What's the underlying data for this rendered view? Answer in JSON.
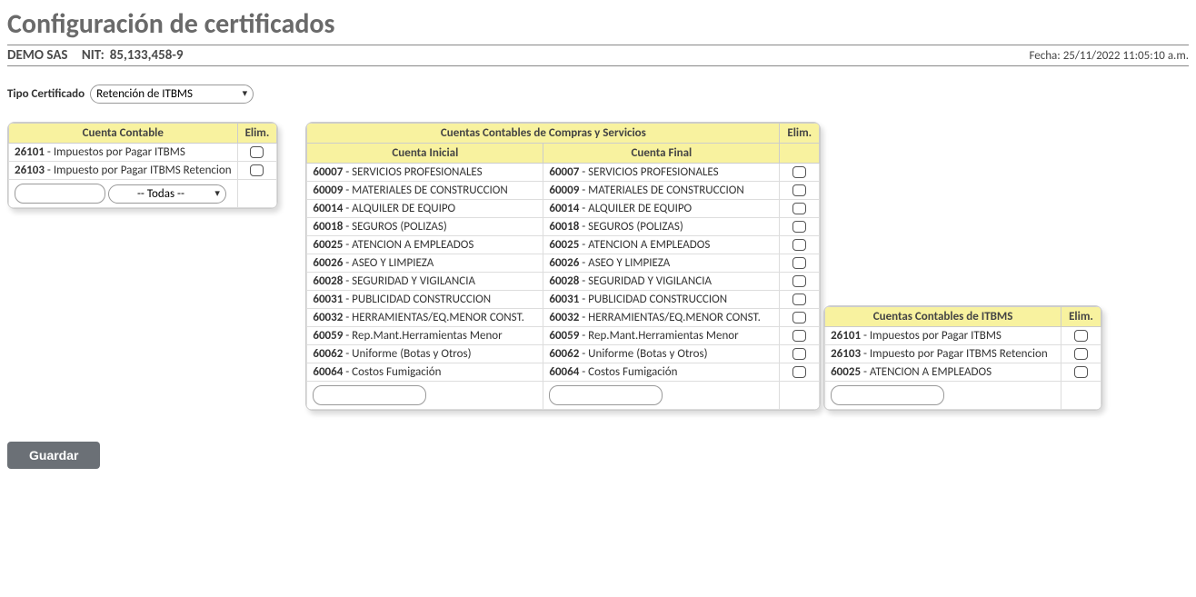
{
  "header": {
    "title": "Configuración de certificados",
    "company": "DEMO SAS",
    "nit_label": "NIT:",
    "nit_value": "85,133,458-9",
    "date_label": "Fecha:",
    "date_value": "25/11/2022 11:05:10 a.m."
  },
  "cert_type": {
    "label": "Tipo Certificado",
    "selected": "Retención de ITBMS"
  },
  "left_table": {
    "header_account": "Cuenta Contable",
    "header_delete": "Elim.",
    "rows": [
      {
        "code": "26101",
        "desc": "Impuestos por Pagar ITBMS"
      },
      {
        "code": "26103",
        "desc": "Impuesto por Pagar ITBMS Retencion"
      }
    ],
    "dropdown_value": "-- Todas --"
  },
  "purchases_table": {
    "header_main": "Cuentas Contables de Compras y Servicios",
    "header_delete": "Elim.",
    "header_initial": "Cuenta Inicial",
    "header_final": "Cuenta Final",
    "rows": [
      {
        "code": "60007",
        "desc": "SERVICIOS PROFESIONALES"
      },
      {
        "code": "60009",
        "desc": "MATERIALES DE CONSTRUCCION"
      },
      {
        "code": "60014",
        "desc": "ALQUILER DE EQUIPO"
      },
      {
        "code": "60018",
        "desc": "SEGUROS (POLIZAS)"
      },
      {
        "code": "60025",
        "desc": "ATENCION A EMPLEADOS"
      },
      {
        "code": "60026",
        "desc": "ASEO Y LIMPIEZA"
      },
      {
        "code": "60028",
        "desc": "SEGURIDAD Y VIGILANCIA"
      },
      {
        "code": "60031",
        "desc": "PUBLICIDAD CONSTRUCCION"
      },
      {
        "code": "60032",
        "desc": "HERRAMIENTAS/EQ.MENOR CONST."
      },
      {
        "code": "60059",
        "desc": "Rep.Mant.Herramientas Menor"
      },
      {
        "code": "60062",
        "desc": "Uniforme (Botas y Otros)"
      },
      {
        "code": "60064",
        "desc": "Costos Fumigación"
      }
    ]
  },
  "itbms_table": {
    "header_main": "Cuentas Contables de ITBMS",
    "header_delete": "Elim.",
    "rows": [
      {
        "code": "26101",
        "desc": "Impuestos por Pagar ITBMS"
      },
      {
        "code": "26103",
        "desc": "Impuesto por Pagar ITBMS Retencion"
      },
      {
        "code": "60025",
        "desc": "ATENCION A EMPLEADOS"
      }
    ]
  },
  "buttons": {
    "save": "Guardar"
  }
}
